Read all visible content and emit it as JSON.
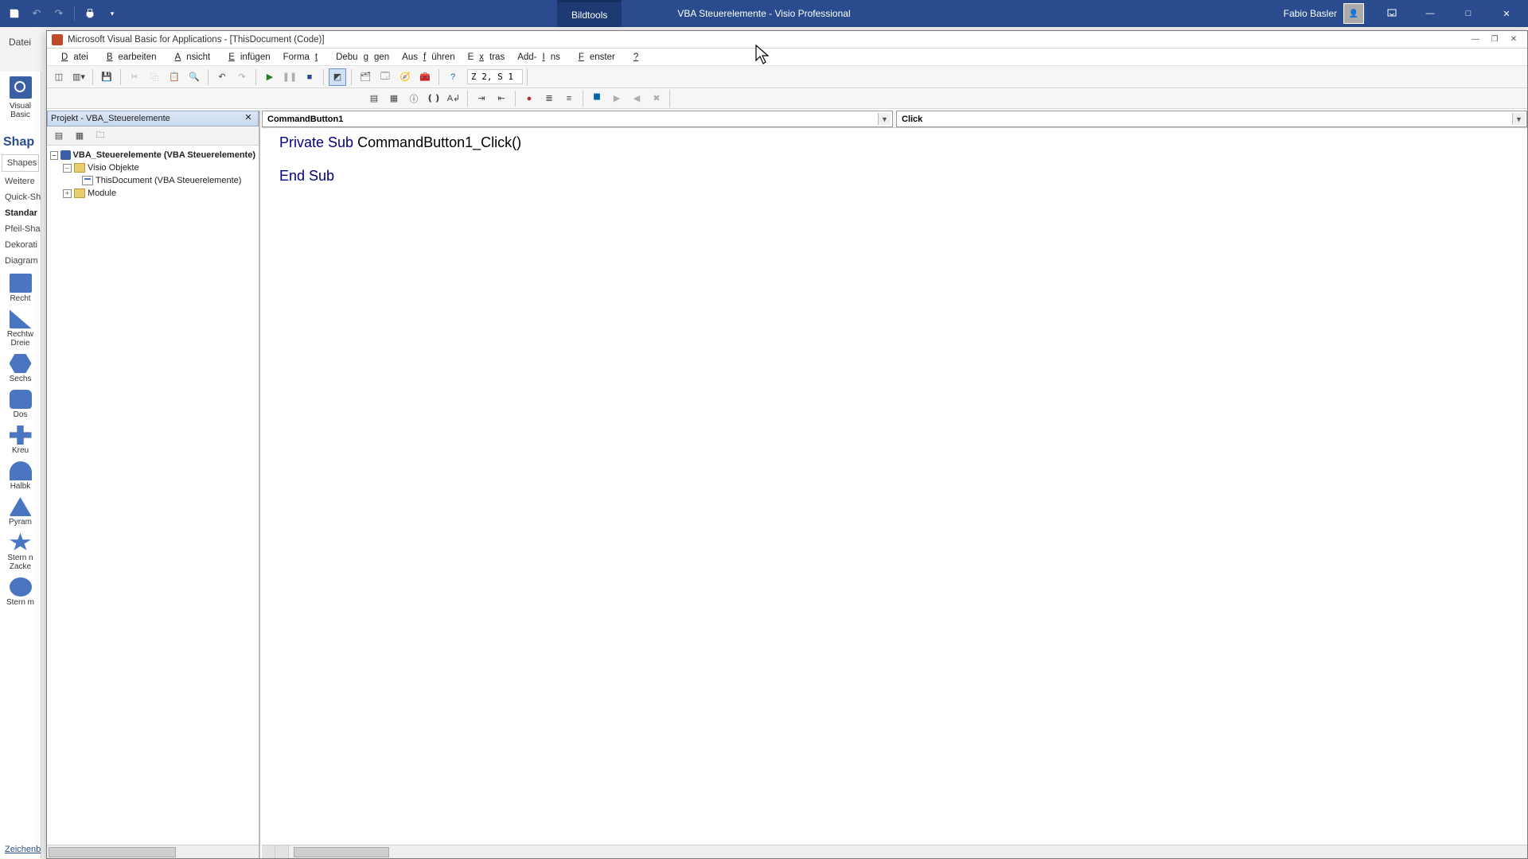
{
  "titlebar": {
    "bildtools": "Bildtools",
    "doc_title": "VBA Steuerelemente  -  Visio Professional",
    "user": "Fabio Basler"
  },
  "visio": {
    "tab_datei": "Datei",
    "vb_label": "Visual\nBasic",
    "shapes_header": "Shap",
    "shapes_search": "Shapes s",
    "categories": [
      "Weitere",
      "Quick-Sh",
      "Standar",
      "Pfeil-Sha",
      "Dekorati",
      "Diagram"
    ],
    "shapes": [
      "Recht",
      "Rechtw\nDreie",
      "Sechs",
      "Dos",
      "Kreu",
      "Halbk",
      "Pyram",
      "Stern n\nZacke",
      "Stern m"
    ],
    "bottom_link": "Zeichenb"
  },
  "vbe": {
    "title": "Microsoft Visual Basic for Applications - [ThisDocument (Code)]",
    "menu": [
      "Datei",
      "Bearbeiten",
      "Ansicht",
      "Einfügen",
      "Format",
      "Debuggen",
      "Ausführen",
      "Extras",
      "Add-Ins",
      "Fenster",
      "?"
    ],
    "position": "Z 2, S 1",
    "project": {
      "title": "Projekt - VBA_Steuerelemente",
      "root": "VBA_Steuerelemente (VBA Steuerelemente)",
      "folder1": "Visio Objekte",
      "doc": "ThisDocument (VBA Steuerelemente)",
      "folder2": "Module"
    },
    "object_combo": "CommandButton1",
    "proc_combo": "Click",
    "code_line1_kw1": "Private Sub",
    "code_line1_rest": " CommandButton1_Click()",
    "code_line3": "End Sub"
  }
}
